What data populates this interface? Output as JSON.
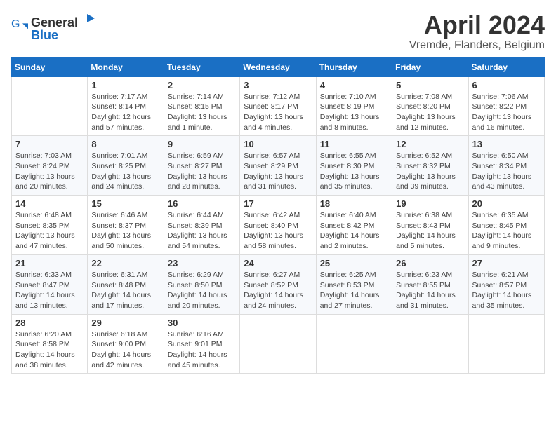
{
  "logo": {
    "general": "General",
    "blue": "Blue"
  },
  "title": "April 2024",
  "location": "Vremde, Flanders, Belgium",
  "weekdays": [
    "Sunday",
    "Monday",
    "Tuesday",
    "Wednesday",
    "Thursday",
    "Friday",
    "Saturday"
  ],
  "weeks": [
    [
      {
        "day": "",
        "info": ""
      },
      {
        "day": "1",
        "info": "Sunrise: 7:17 AM\nSunset: 8:14 PM\nDaylight: 12 hours\nand 57 minutes."
      },
      {
        "day": "2",
        "info": "Sunrise: 7:14 AM\nSunset: 8:15 PM\nDaylight: 13 hours\nand 1 minute."
      },
      {
        "day": "3",
        "info": "Sunrise: 7:12 AM\nSunset: 8:17 PM\nDaylight: 13 hours\nand 4 minutes."
      },
      {
        "day": "4",
        "info": "Sunrise: 7:10 AM\nSunset: 8:19 PM\nDaylight: 13 hours\nand 8 minutes."
      },
      {
        "day": "5",
        "info": "Sunrise: 7:08 AM\nSunset: 8:20 PM\nDaylight: 13 hours\nand 12 minutes."
      },
      {
        "day": "6",
        "info": "Sunrise: 7:06 AM\nSunset: 8:22 PM\nDaylight: 13 hours\nand 16 minutes."
      }
    ],
    [
      {
        "day": "7",
        "info": "Sunrise: 7:03 AM\nSunset: 8:24 PM\nDaylight: 13 hours\nand 20 minutes."
      },
      {
        "day": "8",
        "info": "Sunrise: 7:01 AM\nSunset: 8:25 PM\nDaylight: 13 hours\nand 24 minutes."
      },
      {
        "day": "9",
        "info": "Sunrise: 6:59 AM\nSunset: 8:27 PM\nDaylight: 13 hours\nand 28 minutes."
      },
      {
        "day": "10",
        "info": "Sunrise: 6:57 AM\nSunset: 8:29 PM\nDaylight: 13 hours\nand 31 minutes."
      },
      {
        "day": "11",
        "info": "Sunrise: 6:55 AM\nSunset: 8:30 PM\nDaylight: 13 hours\nand 35 minutes."
      },
      {
        "day": "12",
        "info": "Sunrise: 6:52 AM\nSunset: 8:32 PM\nDaylight: 13 hours\nand 39 minutes."
      },
      {
        "day": "13",
        "info": "Sunrise: 6:50 AM\nSunset: 8:34 PM\nDaylight: 13 hours\nand 43 minutes."
      }
    ],
    [
      {
        "day": "14",
        "info": "Sunrise: 6:48 AM\nSunset: 8:35 PM\nDaylight: 13 hours\nand 47 minutes."
      },
      {
        "day": "15",
        "info": "Sunrise: 6:46 AM\nSunset: 8:37 PM\nDaylight: 13 hours\nand 50 minutes."
      },
      {
        "day": "16",
        "info": "Sunrise: 6:44 AM\nSunset: 8:39 PM\nDaylight: 13 hours\nand 54 minutes."
      },
      {
        "day": "17",
        "info": "Sunrise: 6:42 AM\nSunset: 8:40 PM\nDaylight: 13 hours\nand 58 minutes."
      },
      {
        "day": "18",
        "info": "Sunrise: 6:40 AM\nSunset: 8:42 PM\nDaylight: 14 hours\nand 2 minutes."
      },
      {
        "day": "19",
        "info": "Sunrise: 6:38 AM\nSunset: 8:43 PM\nDaylight: 14 hours\nand 5 minutes."
      },
      {
        "day": "20",
        "info": "Sunrise: 6:35 AM\nSunset: 8:45 PM\nDaylight: 14 hours\nand 9 minutes."
      }
    ],
    [
      {
        "day": "21",
        "info": "Sunrise: 6:33 AM\nSunset: 8:47 PM\nDaylight: 14 hours\nand 13 minutes."
      },
      {
        "day": "22",
        "info": "Sunrise: 6:31 AM\nSunset: 8:48 PM\nDaylight: 14 hours\nand 17 minutes."
      },
      {
        "day": "23",
        "info": "Sunrise: 6:29 AM\nSunset: 8:50 PM\nDaylight: 14 hours\nand 20 minutes."
      },
      {
        "day": "24",
        "info": "Sunrise: 6:27 AM\nSunset: 8:52 PM\nDaylight: 14 hours\nand 24 minutes."
      },
      {
        "day": "25",
        "info": "Sunrise: 6:25 AM\nSunset: 8:53 PM\nDaylight: 14 hours\nand 27 minutes."
      },
      {
        "day": "26",
        "info": "Sunrise: 6:23 AM\nSunset: 8:55 PM\nDaylight: 14 hours\nand 31 minutes."
      },
      {
        "day": "27",
        "info": "Sunrise: 6:21 AM\nSunset: 8:57 PM\nDaylight: 14 hours\nand 35 minutes."
      }
    ],
    [
      {
        "day": "28",
        "info": "Sunrise: 6:20 AM\nSunset: 8:58 PM\nDaylight: 14 hours\nand 38 minutes."
      },
      {
        "day": "29",
        "info": "Sunrise: 6:18 AM\nSunset: 9:00 PM\nDaylight: 14 hours\nand 42 minutes."
      },
      {
        "day": "30",
        "info": "Sunrise: 6:16 AM\nSunset: 9:01 PM\nDaylight: 14 hours\nand 45 minutes."
      },
      {
        "day": "",
        "info": ""
      },
      {
        "day": "",
        "info": ""
      },
      {
        "day": "",
        "info": ""
      },
      {
        "day": "",
        "info": ""
      }
    ]
  ]
}
